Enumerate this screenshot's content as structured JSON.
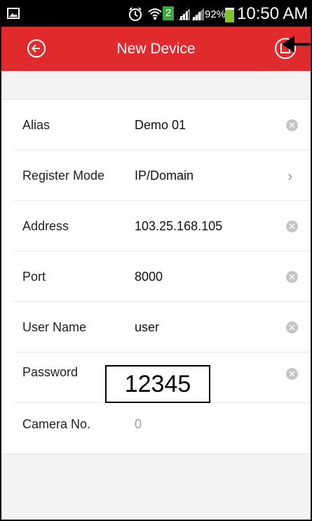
{
  "status_bar": {
    "battery_percent": "92%",
    "time": "10:50 AM",
    "sim_badge": "2",
    "icons": [
      "image-icon",
      "alarm-icon",
      "wifi-icon",
      "signal-icon",
      "signal-icon",
      "battery-icon"
    ]
  },
  "app_bar": {
    "title": "New Device",
    "back_icon": "back-arrow-circle-icon",
    "save_icon": "save-icon",
    "color": "#e02a2e"
  },
  "form": {
    "rows": [
      {
        "label": "Alias",
        "value": "Demo 01",
        "action": "clear"
      },
      {
        "label": "Register Mode",
        "value": "IP/Domain",
        "action": "chevron"
      },
      {
        "label": "Address",
        "value": "103.25.168.105",
        "action": "clear"
      },
      {
        "label": "Port",
        "value": "8000",
        "action": "clear"
      },
      {
        "label": "User Name",
        "value": "user",
        "action": "clear"
      },
      {
        "label": "Password",
        "value": "",
        "action": "clear"
      },
      {
        "label": "Camera No.",
        "value": "0",
        "action": "none"
      }
    ]
  },
  "annotation": {
    "password_callout": "12345",
    "arrow_icon": "pointer-arrow-icon"
  }
}
